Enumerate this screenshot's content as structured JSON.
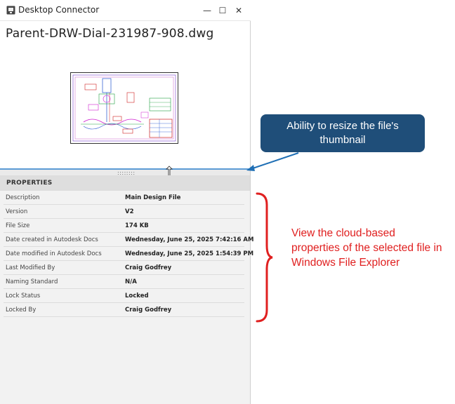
{
  "window": {
    "title": "Desktop Connector",
    "controls": {
      "minimize": "—",
      "maximize": "☐",
      "close": "✕"
    }
  },
  "file": {
    "name": "Parent-DRW-Dial-231987-908.dwg"
  },
  "splitter": {
    "grip": "::::::::"
  },
  "properties": {
    "header": "PROPERTIES",
    "rows": [
      {
        "label": "Description",
        "value": "Main Design File"
      },
      {
        "label": "Version",
        "value": "V2"
      },
      {
        "label": "File Size",
        "value": "174 KB"
      },
      {
        "label": "Date created in Autodesk Docs",
        "value": "Wednesday, June 25, 2025 7:42:16 AM"
      },
      {
        "label": "Date modified in Autodesk Docs",
        "value": "Wednesday, June 25, 2025 1:54:39 PM"
      },
      {
        "label": "Last Modified By",
        "value": "Craig Godfrey"
      },
      {
        "label": "Naming Standard",
        "value": "N/A"
      },
      {
        "label": "Lock Status",
        "value": "Locked"
      },
      {
        "label": "Locked By",
        "value": "Craig Godfrey"
      }
    ]
  },
  "callout": {
    "line1": "Ability to resize the file's",
    "line2": "thumbnail",
    "color": "#1f4e79"
  },
  "annotation": {
    "text": "View the cloud-based properties of the selected file in Windows File Explorer",
    "color": "#e02020"
  },
  "icons": {
    "app": "desktop-connector-icon",
    "resize": "resize-cursor-icon"
  }
}
